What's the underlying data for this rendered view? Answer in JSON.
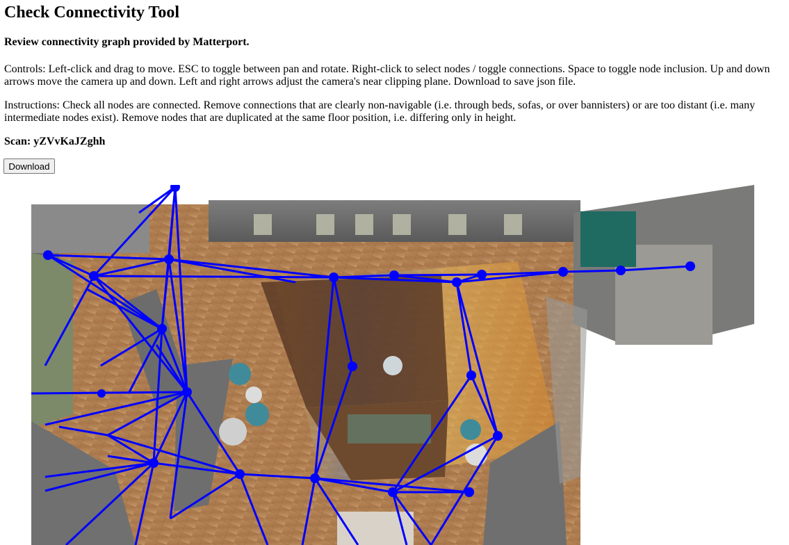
{
  "header": {
    "title": "Check Connectivity Tool",
    "subtitle": "Review connectivity graph provided by Matterport."
  },
  "controls_text": "Controls: Left-click and drag to move. ESC to toggle between pan and rotate. Right-click to select nodes / toggle connections. Space to toggle node inclusion. Up and down arrows move the camera up and down. Left and right arrows adjust the camera's near clipping plane. Download to save json file.",
  "instructions_text": "Instructions: Check all nodes are connected. Remove connections that are clearly non-navigable (i.e. through beds, sofas, or over bannisters) or are too distant (i.e. many intermediate nodes exist). Remove nodes that are duplicated at the same floor position, i.e. differing only in height.",
  "scan": {
    "label": "Scan: yZVvKaJZghh"
  },
  "toolbar": {
    "download_label": "Download"
  },
  "graph": {
    "node_color": "#0000ff",
    "edge_color": "#0000ff",
    "selected_node_color": "#0000ff"
  }
}
